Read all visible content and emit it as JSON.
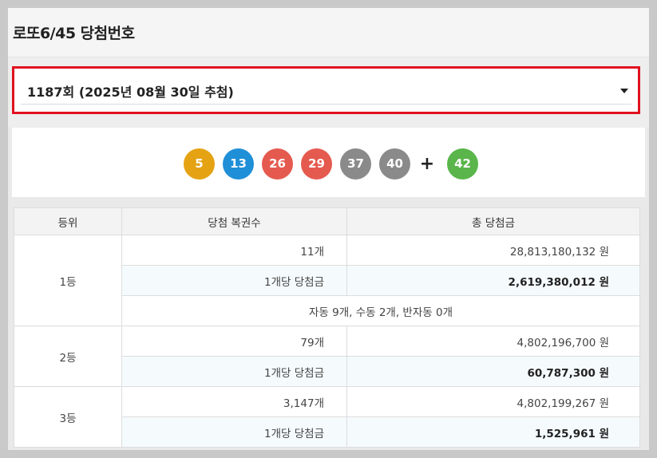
{
  "page": {
    "title": "로또6/45 당첨번호"
  },
  "draw_select": {
    "value": "1187회 (2025년 08월 30일 추첨)"
  },
  "balls": [
    {
      "number": "5",
      "color": "#e5a313"
    },
    {
      "number": "13",
      "color": "#1f8fd7"
    },
    {
      "number": "26",
      "color": "#e55a4f"
    },
    {
      "number": "29",
      "color": "#e55a4f"
    },
    {
      "number": "37",
      "color": "#8a8a8a"
    },
    {
      "number": "40",
      "color": "#8a8a8a"
    }
  ],
  "plus": "+",
  "bonus": {
    "number": "42",
    "color": "#5ab54a"
  },
  "table": {
    "headers": [
      "등위",
      "당첨 복권수",
      "총 당첨금"
    ],
    "ranks": [
      {
        "rank": "1등",
        "winners": "11개",
        "total": "28,813,180,132 원",
        "per_label": "1개당 당첨금",
        "per_amount": "2,619,380,012 원",
        "note": "자동 9개, 수동 2개, 반자동 0개"
      },
      {
        "rank": "2등",
        "winners": "79개",
        "total": "4,802,196,700 원",
        "per_label": "1개당 당첨금",
        "per_amount": "60,787,300 원"
      },
      {
        "rank": "3등",
        "winners": "3,147개",
        "total": "4,802,199,267 원",
        "per_label": "1개당 당첨금",
        "per_amount": "1,525,961 원"
      }
    ]
  }
}
